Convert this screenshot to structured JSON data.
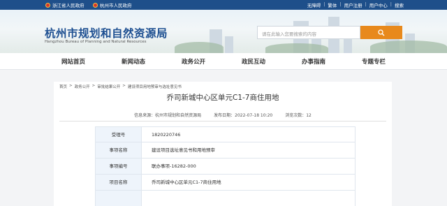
{
  "topbar": {
    "gov_links": [
      "浙江省人民政府",
      "杭州市人民政府"
    ],
    "right_links": [
      "无障碍",
      "繁体",
      "用户注册",
      "用户中心",
      "搜索"
    ],
    "separator": "|"
  },
  "header": {
    "title": "杭州市规划和自然资源局",
    "subtitle": "Hangzhou Bureau of Planning and Natural Resources",
    "search_placeholder": "请在此输入您要搜索的内容"
  },
  "nav": {
    "items": [
      "网站首页",
      "新闻动态",
      "政务公开",
      "政民互动",
      "办事指南",
      "专题专栏"
    ]
  },
  "breadcrumb": {
    "items": [
      "首页",
      "政务公开",
      "审批结果公开",
      "建设项目用地预审与选址意见书"
    ],
    "separator": ">"
  },
  "article": {
    "title": "乔司新城中心区单元C1-7商住用地",
    "source": "信息来源：杭州市规划和自然资源局",
    "date": "发布日期：2022-07-18 10:20",
    "views": "浏览次数：12"
  },
  "table": [
    {
      "label": "受理号",
      "value": "1820220746"
    },
    {
      "label": "事项名称",
      "value": "建设项目选址意见书和用地预审"
    },
    {
      "label": "事项编号",
      "value": "联办事项-16282-000"
    },
    {
      "label": "项目名称",
      "value": "乔司新城中心区单元C1-7商住用地"
    },
    {
      "label": "",
      "value": ""
    }
  ],
  "colors": {
    "topbar": "#1e4f8a",
    "title_blue": "#1d4f91",
    "search_button": "#e8891c",
    "label_bg": "#eef4fb"
  }
}
